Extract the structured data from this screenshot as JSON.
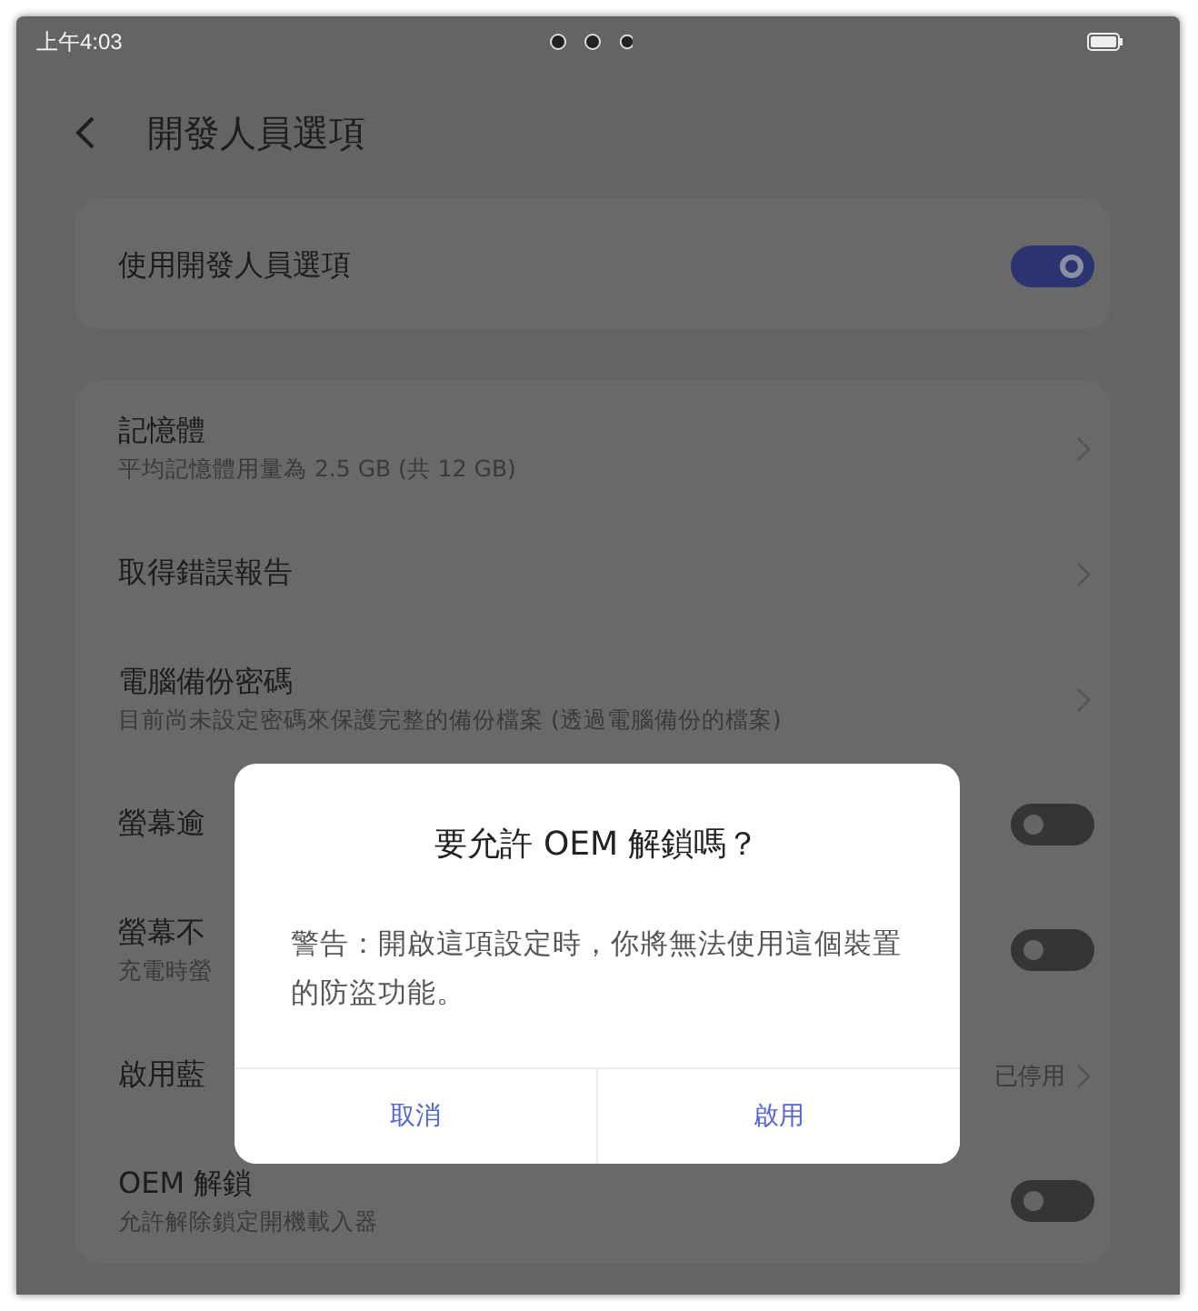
{
  "status_bar": {
    "time": "上午4:03"
  },
  "header": {
    "title": "開發人員選項"
  },
  "sections": [
    {
      "items": [
        {
          "kind": "toggle",
          "title": "使用開發人員選項",
          "on": true
        }
      ]
    },
    {
      "items": [
        {
          "kind": "link",
          "title": "記憶體",
          "subtitle": "平均記憶體用量為 2.5 GB (共 12 GB)"
        },
        {
          "kind": "link",
          "title": "取得錯誤報告"
        },
        {
          "kind": "link",
          "title": "電腦備份密碼",
          "subtitle": "目前尚未設定密碼來保護完整的備份檔案 (透過電腦備份的檔案)"
        },
        {
          "kind": "toggle",
          "title": "螢幕逾",
          "on": false
        },
        {
          "kind": "toggle",
          "title": "螢幕不",
          "subtitle": "充電時螢",
          "on": false
        },
        {
          "kind": "value",
          "title": "啟用藍",
          "value": "已停用"
        },
        {
          "kind": "toggle",
          "title": "OEM 解鎖",
          "subtitle": "允許解除鎖定開機載入器",
          "on": false
        }
      ]
    }
  ],
  "dialog": {
    "title": "要允許 OEM 解鎖嗎？",
    "message": "警告：開啟這項設定時，你將無法使用這個裝置的防盜功能。",
    "buttons": [
      "取消",
      "啟用"
    ]
  }
}
